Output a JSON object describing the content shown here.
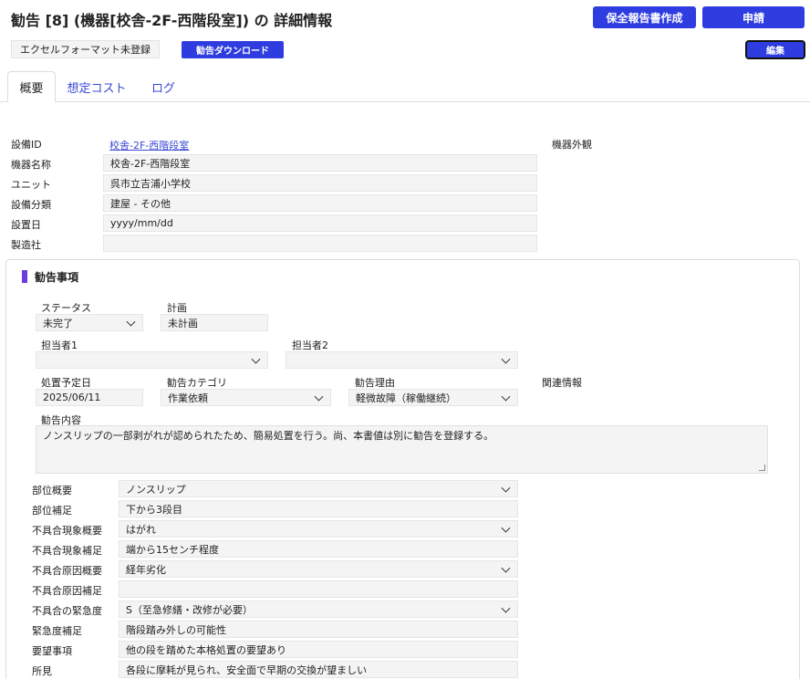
{
  "header": {
    "title": "勧告 [8] (機器[校舎-2F-西階段室]) の 詳細情報",
    "create_report_label": "保全報告書作成",
    "apply_label": "申請",
    "excel_status": "エクセルフォーマット未登録",
    "download_label": "勧告ダウンロード",
    "edit_label": "編集"
  },
  "tabs": [
    {
      "label": "概要",
      "active": true
    },
    {
      "label": "想定コスト",
      "active": false
    },
    {
      "label": "ログ",
      "active": false
    }
  ],
  "equipment": {
    "id_label": "設備ID",
    "id_value": "校舎-2F-西階段室",
    "name_label": "機器名称",
    "name_value": "校舎-2F-西階段室",
    "unit_label": "ユニット",
    "unit_value": "呉市立吉浦小学校",
    "category_label": "設備分類",
    "category_value": "建屋 - その他",
    "install_date_label": "設置日",
    "install_date_placeholder": "yyyy/mm/dd",
    "maker_label": "製造社",
    "maker_value": "",
    "appearance_label": "機器外観"
  },
  "recommendation": {
    "section_title": "勧告事項",
    "status_label": "ステータス",
    "status_value": "未完了",
    "plan_label": "計画",
    "plan_value": "未計画",
    "assignee1_label": "担当者1",
    "assignee1_value": "",
    "assignee2_label": "担当者2",
    "assignee2_value": "",
    "scheduled_date_label": "処置予定日",
    "scheduled_date_value": "2025/06/11",
    "category_label": "勧告カテゴリ",
    "category_value": "作業依頼",
    "reason_label": "勧告理由",
    "reason_value": "軽微故障（稼働継続）",
    "related_label": "関連情報",
    "content_label": "勧告内容",
    "content_value": "ノンスリップの一部剥がれが認められたため、簡易処置を行う。尚、本書値は別に勧告を登録する。",
    "part_summary_label": "部位概要",
    "part_summary_value": "ノンスリップ",
    "part_detail_label": "部位補足",
    "part_detail_value": "下から3段目",
    "defect_summary_label": "不具合現象概要",
    "defect_summary_value": "はがれ",
    "defect_detail_label": "不具合現象補足",
    "defect_detail_value": "端から15センチ程度",
    "cause_summary_label": "不具合原因概要",
    "cause_summary_value": "経年劣化",
    "cause_detail_label": "不具合原因補足",
    "cause_detail_value": "",
    "urgency_label": "不具合の緊急度",
    "urgency_value": "S（至急修繕・改修が必要）",
    "urgency_detail_label": "緊急度補足",
    "urgency_detail_value": "階段踏み外しの可能性",
    "request_label": "要望事項",
    "request_value": "他の段を踏めた本格処置の要望あり",
    "findings_label": "所見",
    "findings_value": "各段に摩耗が見られ、安全面で早期の交換が望ましい"
  },
  "colors": {
    "primary": "#2f3de0",
    "section_accent": "#6a3de0",
    "link": "#3a48d4"
  }
}
